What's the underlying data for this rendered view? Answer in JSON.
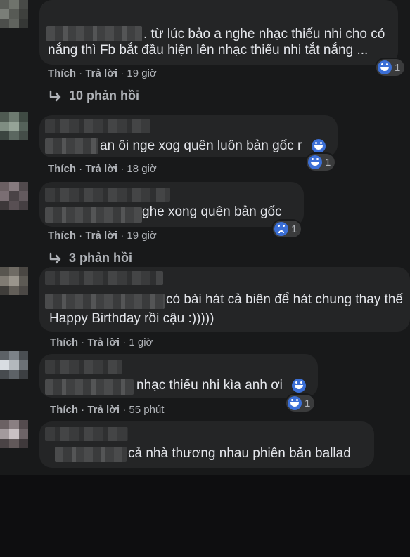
{
  "comments": [
    {
      "text": ". từ lúc bảo a nghe nhạc thiếu nhi cho có nắng thì Fb bắt đầu hiện lên nhạc thiếu nhi tắt nắng ...",
      "line1": ". từ lúc bảo a nghe nhạc thiếu nhi cho có",
      "line2": "nắng thì Fb bắt đầu hiện lên nhạc thiếu nhi tắt nắng ...",
      "like": "Thích",
      "reply": "Trả lời",
      "time": "19 giờ",
      "reaction_icon": "laugh-cry-icon",
      "reaction_count": "1",
      "replies_label": "10 phản hồi"
    },
    {
      "text": "an ôi nge xog quên luôn bản gốc r",
      "like": "Thích",
      "reply": "Trả lời",
      "time": "18 giờ",
      "reaction_icon": "laugh-cry-icon",
      "reaction_count": "1"
    },
    {
      "text": "ghe xong quên bản gốc",
      "like": "Thích",
      "reply": "Trả lời",
      "time": "19 giờ",
      "reaction_icon": "sad-icon",
      "reaction_count": "1",
      "replies_label": "3 phản hồi"
    },
    {
      "line1": "có bài hát cả biên để hát chung thay thế",
      "line2": "Happy Birthday rồi cậu :)))))",
      "like": "Thích",
      "reply": "Trả lời",
      "time": "1 giờ"
    },
    {
      "text": "nhạc thiếu nhi kìa anh ơi",
      "like": "Thích",
      "reply": "Trả lời",
      "time": "55 phút",
      "reaction_icon": "laugh-cry-icon",
      "reaction_count": "1"
    },
    {
      "text": "cả nhà thương nhau phiên bản ballad"
    }
  ],
  "separator": "·",
  "colors": {
    "background": "#18191a",
    "bubble": "#242526",
    "text": "#e4e6eb",
    "muted": "#b0b3b8",
    "reaction_blue": "#3b6fd6"
  }
}
